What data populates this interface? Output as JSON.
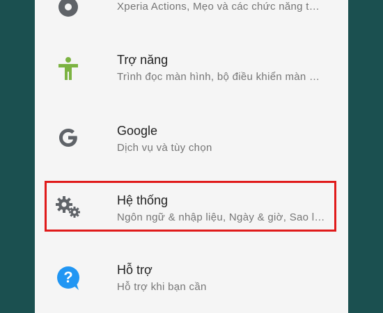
{
  "settings_list": {
    "items": [
      {
        "key": "xperia",
        "title": "",
        "subtitle": "Xperia Actions, Mẹo và các chức năng t…",
        "icon": "xperia-icon"
      },
      {
        "key": "accessibility",
        "title": "Trợ năng",
        "subtitle": "Trình đọc màn hình, bộ điều khiển màn …",
        "icon": "accessibility-icon"
      },
      {
        "key": "google",
        "title": "Google",
        "subtitle": "Dịch vụ và tùy chọn",
        "icon": "google-icon"
      },
      {
        "key": "system",
        "title": "Hệ thống",
        "subtitle": "Ngôn ngữ & nhập liệu, Ngày & giờ, Sao l…",
        "icon": "gears-icon"
      },
      {
        "key": "support",
        "title": "Hỗ trợ",
        "subtitle": "Hỗ trợ khi bạn cần",
        "icon": "help-icon"
      }
    ]
  },
  "colors": {
    "background": "#1b5050",
    "panel": "#f5f5f5",
    "highlight": "#e01b1b",
    "accessibility_green": "#7cb342",
    "icon_gray": "#5f6368",
    "help_blue": "#2196f3"
  }
}
